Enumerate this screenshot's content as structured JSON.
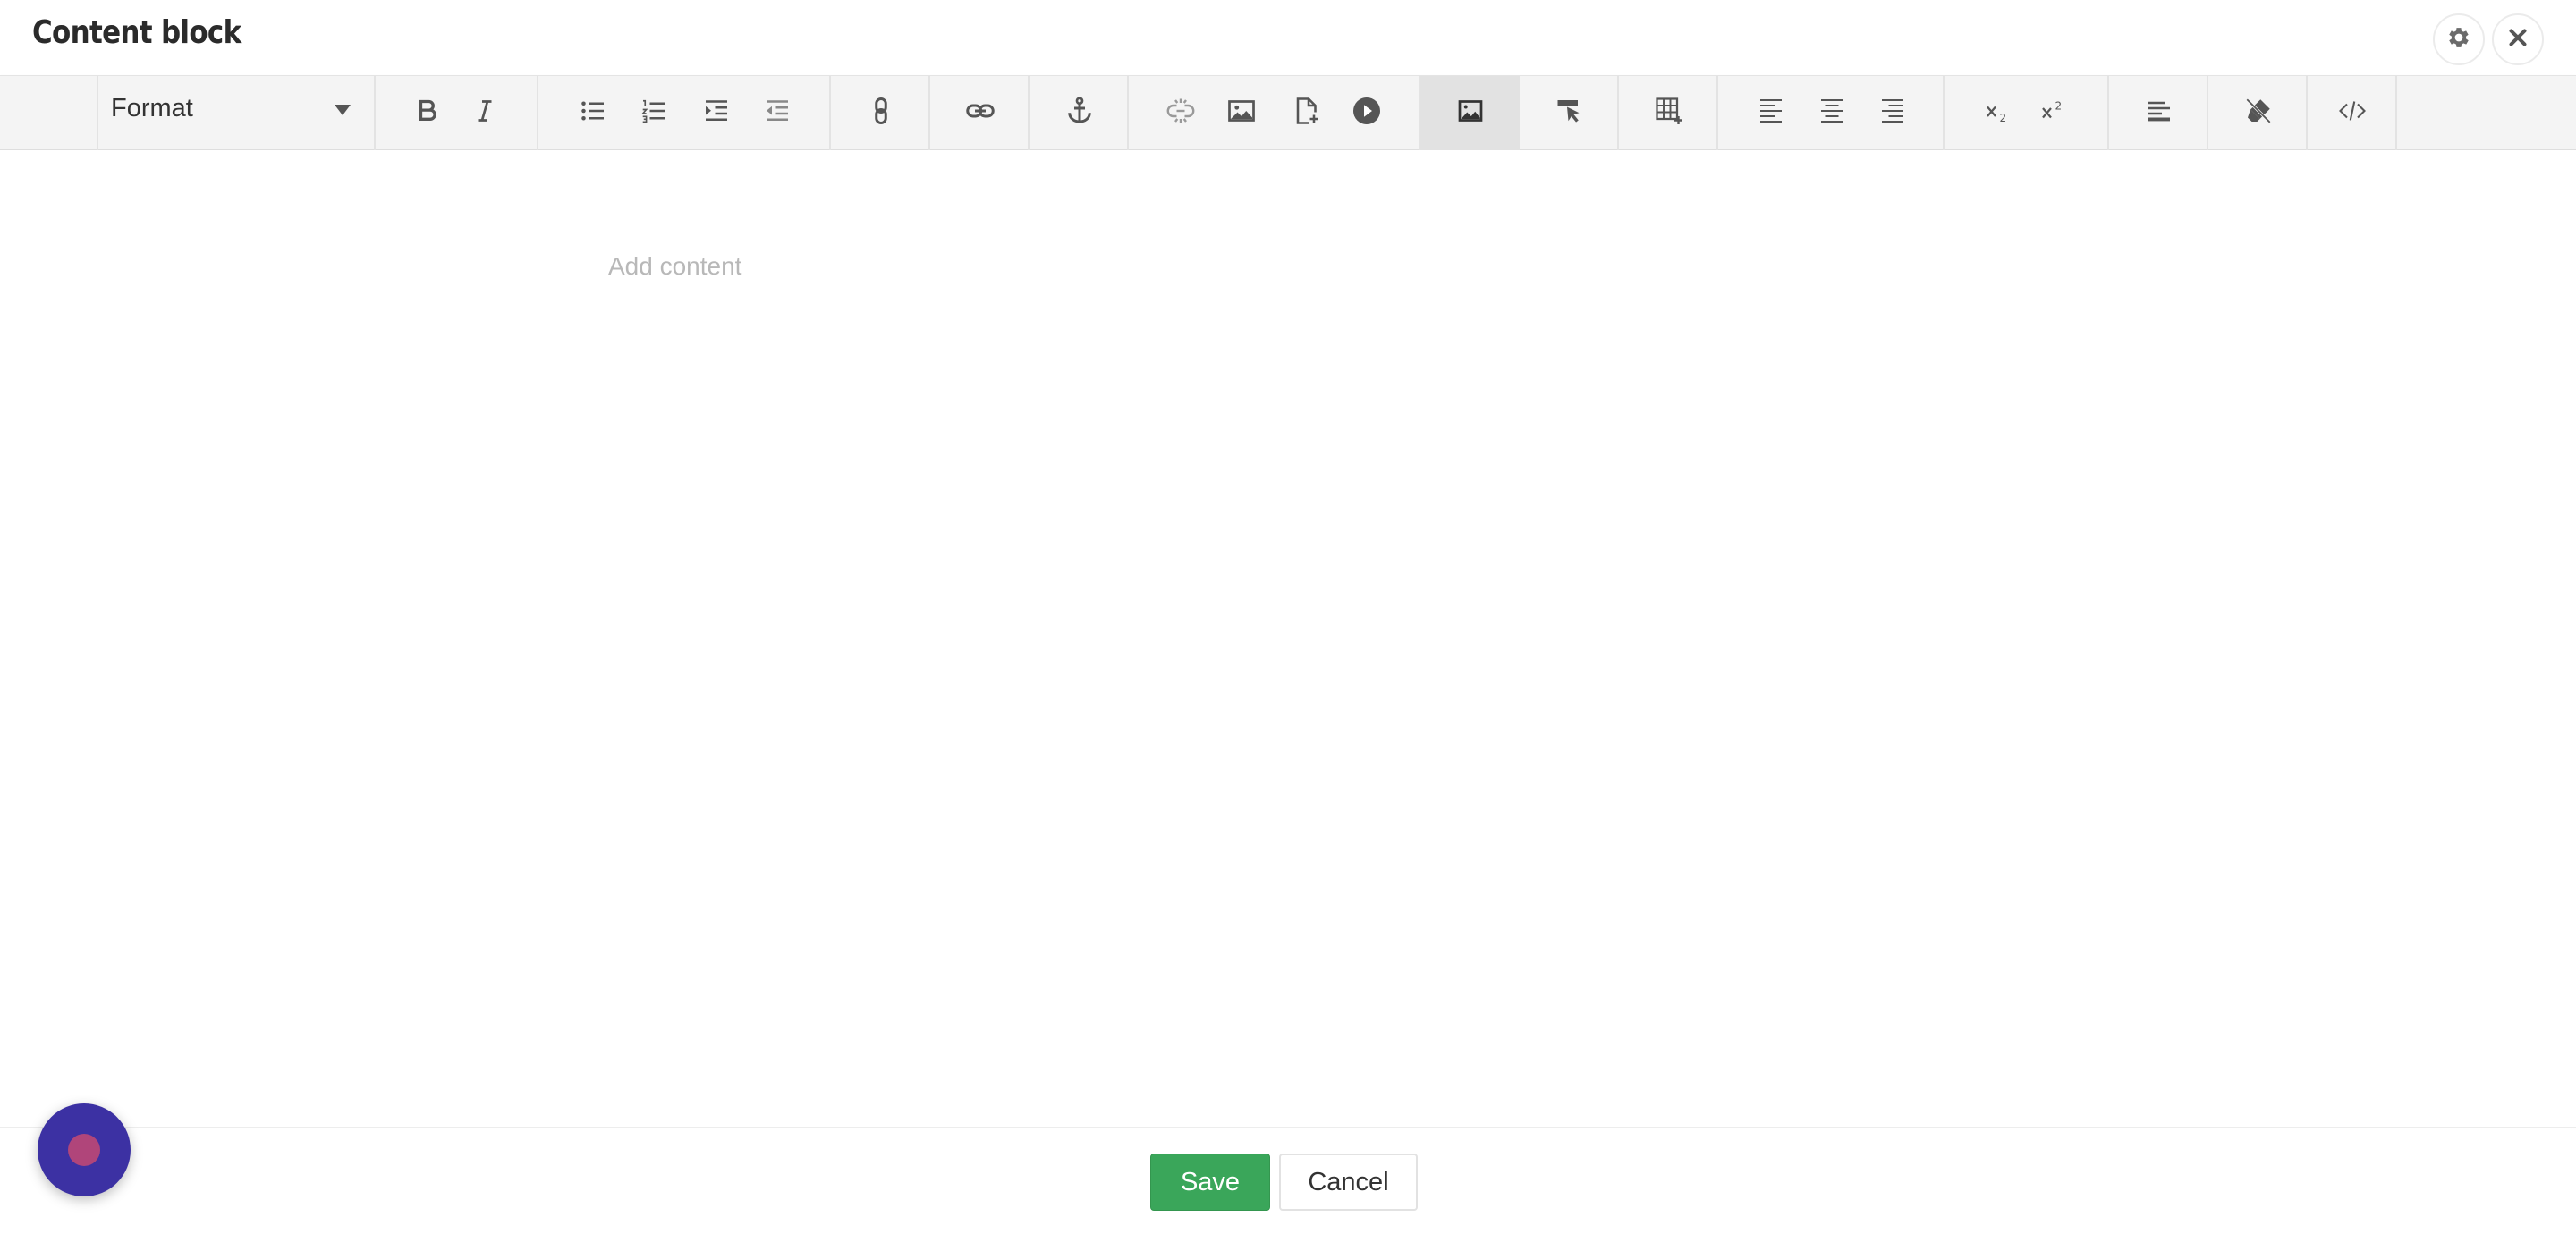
{
  "header": {
    "title": "Content block",
    "settings_icon": "gear-icon",
    "close_icon": "close-icon"
  },
  "toolbar": {
    "format_label": "Format",
    "buttons": [
      "bold",
      "italic",
      "bullet-list",
      "numbered-list",
      "indent",
      "outdent",
      "link",
      "insert-link",
      "anchor",
      "unlink",
      "image",
      "insert-file",
      "embed-media",
      "insert-image",
      "select-element",
      "insert-table",
      "align-left",
      "align-center",
      "align-right",
      "subscript",
      "superscript",
      "paragraph-format",
      "clear-formatting",
      "source-code"
    ],
    "active_button": "insert-image"
  },
  "editor": {
    "placeholder": "Add content"
  },
  "footer": {
    "save_label": "Save",
    "cancel_label": "Cancel"
  },
  "colors": {
    "save": "#3aa65a",
    "launcher": "#3c31a3",
    "launcher_dot": "#b0457a",
    "toolbar_bg": "#f4f4f4"
  }
}
